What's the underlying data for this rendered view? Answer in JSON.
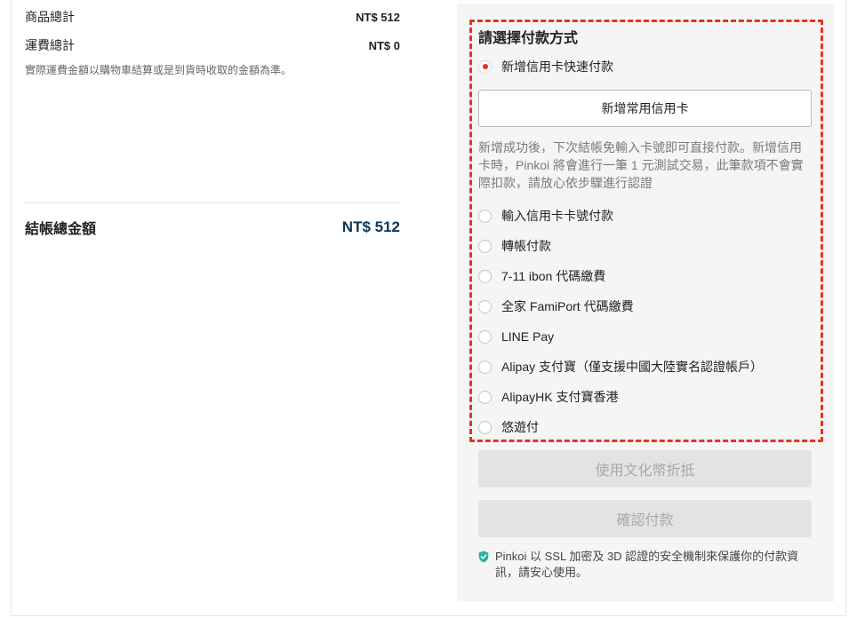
{
  "summary": {
    "items_label": "商品總計",
    "items_value": "NT$ 512",
    "shipping_label": "運費總計",
    "shipping_value": "NT$ 0",
    "shipping_note": "實際運費金額以購物車結算或是到貨時收取的金額為準。",
    "total_label": "結帳總金額",
    "total_value": "NT$ 512"
  },
  "payment": {
    "title": "請選擇付款方式",
    "quick_pay_label": "新增信用卡快速付款",
    "add_card_button": "新增常用信用卡",
    "card_note": "新增成功後，下次結帳免輸入卡號即可直接付款。新增信用卡時，Pinkoi 將會進行一筆 1 元測試交易，此筆款項不會實際扣款，請放心依步驟進行認證",
    "options": [
      "輸入信用卡卡號付款",
      "轉帳付款",
      "7-11 ibon 代碼繳費",
      "全家 FamiPort 代碼繳費",
      "LINE Pay",
      "Alipay 支付寶（僅支援中國大陸實名認證帳戶）",
      "AlipayHK 支付寶香港",
      "悠遊付"
    ],
    "selected": "新增信用卡快速付款",
    "coin_button": "使用文化幣折抵",
    "confirm_button": "確認付款",
    "secure_note": "Pinkoi 以 SSL 加密及 3D 認證的安全機制來保護你的付款資訊，請安心使用。"
  },
  "colors": {
    "accent": "#e8321e",
    "total": "#0d3557",
    "shield": "#2bb3a0"
  },
  "icons": {
    "shield": "shield-check-icon"
  }
}
